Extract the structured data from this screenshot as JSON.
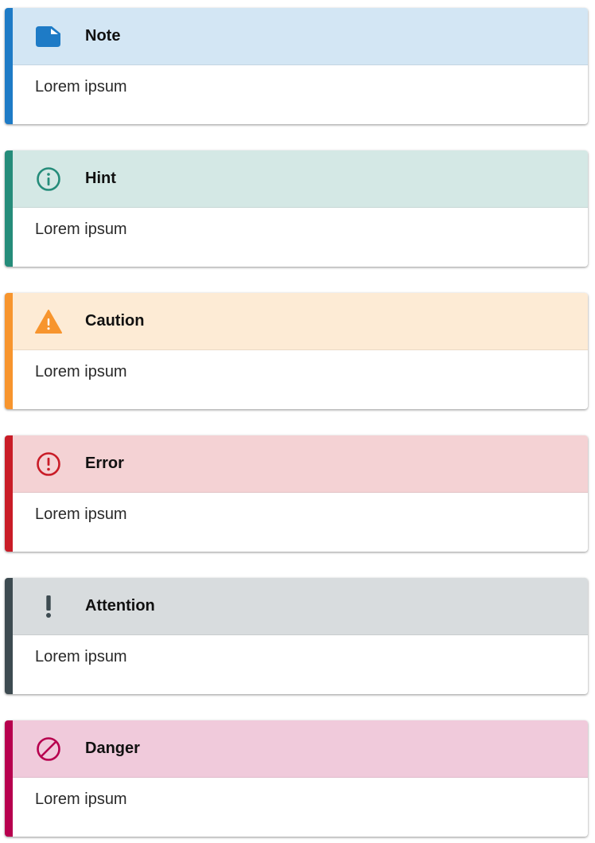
{
  "admonitions": [
    {
      "title": "Note",
      "body": "Lorem ipsum",
      "icon": "note-icon",
      "accent": "#1e7bc6",
      "header_bg": "#d3e6f4"
    },
    {
      "title": "Hint",
      "body": "Lorem ipsum",
      "icon": "info-circle-icon",
      "accent": "#258c7a",
      "header_bg": "#d4e8e5"
    },
    {
      "title": "Caution",
      "body": "Lorem ipsum",
      "icon": "warning-triangle-icon",
      "accent": "#f7952e",
      "header_bg": "#fdebd5"
    },
    {
      "title": "Error",
      "body": "Lorem ipsum",
      "icon": "error-circle-icon",
      "accent": "#c91c27",
      "header_bg": "#f4d2d4"
    },
    {
      "title": "Attention",
      "body": "Lorem ipsum",
      "icon": "exclamation-icon",
      "accent": "#3d4b51",
      "header_bg": "#d8dcde"
    },
    {
      "title": "Danger",
      "body": "Lorem ipsum",
      "icon": "prohibited-icon",
      "accent": "#b7004e",
      "header_bg": "#f0cadb"
    }
  ]
}
